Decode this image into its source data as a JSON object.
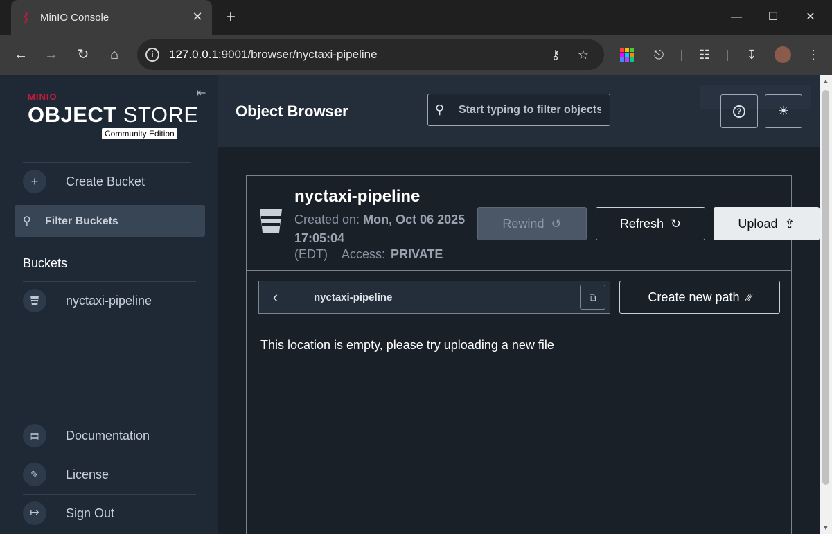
{
  "browser": {
    "tab_title": "MinIO Console",
    "tab_close": "✕",
    "new_tab": "+",
    "url_host": "127.0.0.1",
    "url_path": ":9001/browser/nyctaxi-pipeline"
  },
  "sidebar": {
    "brand": "MINIO",
    "product_bold": "OBJECT",
    "product_rest": " STORE",
    "edition": "Community Edition",
    "create_bucket": "Create Bucket",
    "filter_placeholder": "Filter Buckets",
    "buckets_heading": "Buckets",
    "buckets": [
      {
        "name": "nyctaxi-pipeline"
      }
    ],
    "documentation": "Documentation",
    "license": "License",
    "sign_out": "Sign Out"
  },
  "header": {
    "title": "Object Browser",
    "search_placeholder": "Start typing to filter objects in the bucket"
  },
  "bucket": {
    "name": "nyctaxi-pipeline",
    "created_label": "Created on:",
    "created_value": "Mon, Oct 06 2025 17:05:04",
    "timezone": "(EDT)",
    "access_label": "Access:",
    "access_value": "PRIVATE",
    "rewind_label": "Rewind",
    "refresh_label": "Refresh",
    "upload_label": "Upload"
  },
  "browser_panel": {
    "breadcrumb": "nyctaxi-pipeline",
    "create_path_label": "Create new path",
    "empty_message": "This location is empty, please try uploading a new file"
  },
  "colors": {
    "brand_red": "#c51b3b",
    "sidebar_bg": "#1f2935",
    "main_bg": "#1a2028"
  }
}
